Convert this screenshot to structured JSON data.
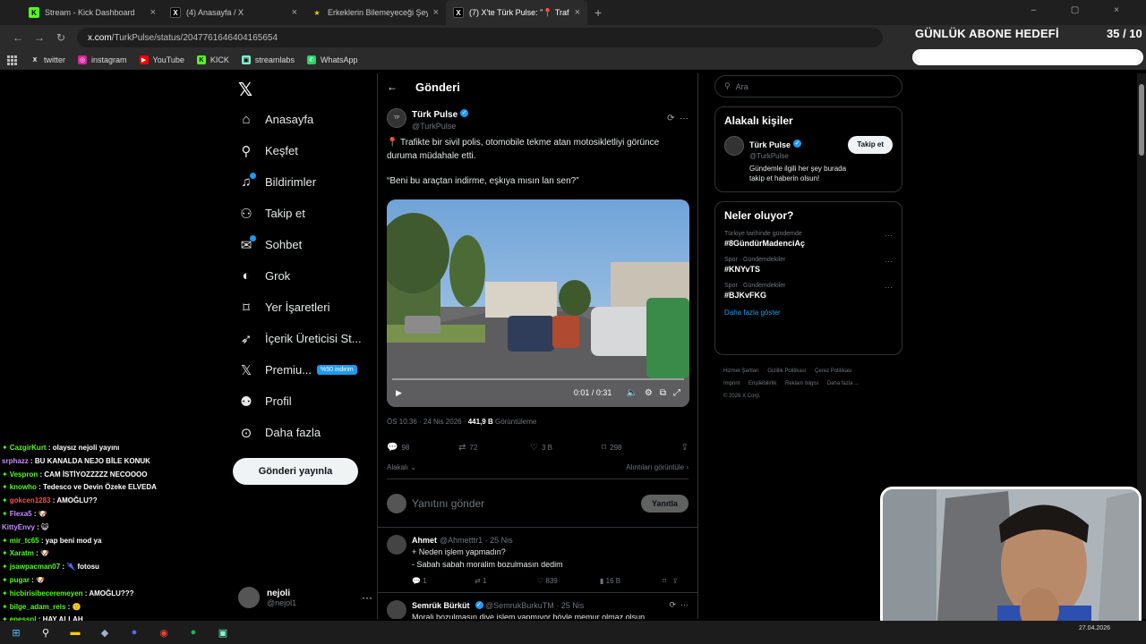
{
  "browser": {
    "tabs": [
      {
        "label": "Stream - Kick Dashboard",
        "favicon": "K",
        "color": "#53fc18"
      },
      {
        "label": "(4) Anasayfa / X",
        "favicon": "X",
        "color": "#000000"
      },
      {
        "label": "Erkeklerin Bilemeyeceği Şeyler",
        "favicon": "★",
        "color": "#f6c915"
      },
      {
        "label": "(7) X'te Türk Pulse: \"📍 Trafikte bi",
        "favicon": "X",
        "color": "#000000"
      }
    ],
    "url_host": "x.com",
    "url_path": "/TurkPulse/status/2047761646404165654",
    "bookmarks": [
      {
        "label": "twitter",
        "icon": "X",
        "color": "#000000"
      },
      {
        "label": "instagram",
        "icon": "◎",
        "color": "#d6249f"
      },
      {
        "label": "YouTube",
        "icon": "▶",
        "color": "#ff0000"
      },
      {
        "label": "KICK",
        "icon": "K",
        "color": "#53fc18"
      },
      {
        "label": "streamlabs",
        "icon": "▣",
        "color": "#80f5d2"
      },
      {
        "label": "WhatsApp",
        "icon": "✆",
        "color": "#25d366"
      }
    ]
  },
  "goal": {
    "title": "GÜNLÜK ABONE HEDEFİ",
    "count": "35 / 10",
    "fill_fraction": 1.0
  },
  "nav": {
    "items": [
      {
        "label": "Anasayfa",
        "icon": "home-icon",
        "glyph": "⌂"
      },
      {
        "label": "Keşfet",
        "icon": "search-icon",
        "glyph": "⌕"
      },
      {
        "label": "Bildirimler",
        "icon": "bell-icon",
        "glyph": "🔔",
        "dot": true
      },
      {
        "label": "Takip et",
        "icon": "person-plus-icon",
        "glyph": "👤"
      },
      {
        "label": "Sohbet",
        "icon": "chat-icon",
        "glyph": "💬",
        "dot": true
      },
      {
        "label": "Grok",
        "icon": "grok-icon",
        "glyph": "◐"
      },
      {
        "label": "Yer İşaretleri",
        "icon": "bookmark-icon",
        "glyph": "🔖"
      },
      {
        "label": "İçerik Üreticisi St...",
        "icon": "rocket-icon",
        "glyph": "🚀"
      },
      {
        "label": "Premiu...",
        "icon": "x-icon",
        "glyph": "𝕏",
        "badge": "%50 indirim"
      },
      {
        "label": "Profil",
        "icon": "person-icon",
        "glyph": "👤"
      },
      {
        "label": "Daha fazla",
        "icon": "more-icon",
        "glyph": "⋯"
      }
    ],
    "post_button": "Gönderi yayınla",
    "profile_name": "nejoli",
    "profile_handle": "@nejol1"
  },
  "main": {
    "header": "Gönderi",
    "tweet": {
      "author": "Türk Pulse",
      "handle": "@TurkPulse",
      "text1": "📍 Trafikte bir sivil polis, otomobile tekme atan motosikletliyi görünce duruma müdahale etti.",
      "text2": "“Beni bu araçtan indirme, eşkıya mısın lan sen?”",
      "video_time": "0:01 / 0:31",
      "timestamp": "ÖS 10:36 · 24 Nis 2026 · ",
      "views": "441,9 B",
      "views_label": " Görüntüleme",
      "replies": "98",
      "reposts": "72",
      "likes": "3 B",
      "bookmarks": "298",
      "relevant": "Alakalı",
      "quotes": "Alıntıları görüntüle"
    },
    "reply_placeholder": "Yanıtını gönder",
    "reply_button": "Yanıtla",
    "replies": [
      {
        "name": "Ahmet",
        "handle": "@Ahmetttr1 · 25 Nis",
        "line1": "+ Neden işlem yapmadın?",
        "line2": "- Sabah sabah moralim bozulmasın dedim",
        "replies": "1",
        "reposts": "1",
        "likes": "839",
        "views": "16 B"
      },
      {
        "name": "Semrük Bürküt",
        "handle": "@SemrukBurkuTM · 25 Nis",
        "line1": "Morali bozulmasın diye işlem yapmıyor böyle memur olmaz olsun",
        "line2": "",
        "replies": "",
        "reposts": "",
        "likes": "",
        "views": ""
      }
    ]
  },
  "right": {
    "search_placeholder": "Ara",
    "related_title": "Alakalı kişiler",
    "related_name": "Türk Pulse",
    "related_handle": "@TurkPulse",
    "related_bio": "Gündemle ilgili her şey burada takip et haberin olsun!",
    "follow_label": "Takip et",
    "trends_title": "Neler oluyor?",
    "trends": [
      {
        "context": "Türkiye tarihinde gündemde",
        "tag": "#8GündürMadenciAç"
      },
      {
        "context": "Spor · Gündemdekiler",
        "tag": "#KNYvTS"
      },
      {
        "context": "Spor · Gündemdekiler",
        "tag": "#BJKvFKG"
      }
    ],
    "show_more": "Daha fazla göster",
    "footer": [
      "Hizmet Şartları",
      "Gizlilik Politikası",
      "Çerez Politikası",
      "Imprint",
      "Erişilebilirlik",
      "Reklam bilgisi",
      "Daha fazla ...",
      "© 2026 X Corp."
    ]
  },
  "chat": [
    {
      "user": "CazgirKurt",
      "msg": " : olaysız nejoli yayını",
      "color": "#53fc18",
      "badge": true
    },
    {
      "user": "srphazz",
      "msg": " : BU KANALDA NEJO BİLE KONUK",
      "color": "#c68cff",
      "badge": false
    },
    {
      "user": "Vespron",
      "msg": " : CAM İSTİYOZZZZZ NECOOOO",
      "color": "#53fc18",
      "badge": true
    },
    {
      "user": "knowho",
      "msg": " : Tedesco ve Devin Özeke ELVEDA",
      "color": "#53fc18",
      "badge": true
    },
    {
      "user": "gokcen1283",
      "msg": " : AMOĞLU??",
      "color": "#ff4d4d",
      "badge": true
    },
    {
      "user": "Flexa5",
      "msg": " : 🐶",
      "color": "#c68cff",
      "badge": true
    },
    {
      "user": "KittyEnvy",
      "msg": " : 😺",
      "color": "#c68cff",
      "badge": false
    },
    {
      "user": "mir_tc65",
      "msg": " : yap beni mod ya",
      "color": "#53fc18",
      "badge": true
    },
    {
      "user": "Xaratm",
      "msg": " : 🐶",
      "color": "#53fc18",
      "badge": true
    },
    {
      "user": "jsawpacman07",
      "msg": " : 🌂 fotosu",
      "color": "#53fc18",
      "badge": true
    },
    {
      "user": "pugar",
      "msg": " : 🐶",
      "color": "#53fc18",
      "badge": true
    },
    {
      "user": "hicbirisibeceremeyen",
      "msg": " : AMOĞLU???",
      "color": "#53fc18",
      "badge": true
    },
    {
      "user": "bilge_adam_reis",
      "msg": " : 🙂",
      "color": "#53fc18",
      "badge": true
    },
    {
      "user": "enessnl",
      "msg": " : HAY ALLAH",
      "color": "#53fc18",
      "badge": true
    }
  ],
  "taskbar": {
    "date": "27.04.2026"
  }
}
